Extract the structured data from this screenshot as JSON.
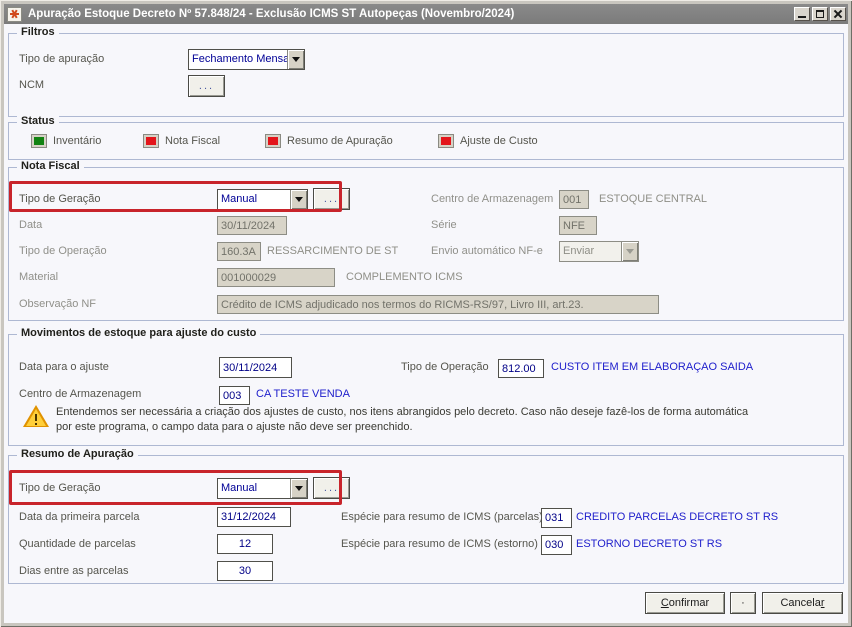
{
  "window": {
    "title": "Apuração Estoque Decreto Nº 57.848/24 - Exclusão ICMS ST Autopeças (Novembro/2024)"
  },
  "groups": {
    "filtros": {
      "title": "Filtros",
      "tipo_apuracao_label": "Tipo de apuração",
      "tipo_apuracao_value": "Fechamento Mensal",
      "ncm_label": "NCM",
      "ncm_button_label": "..."
    },
    "status": {
      "title": "Status",
      "items": [
        {
          "label": "Inventário",
          "color": "#128312",
          "style": "background:#128312"
        },
        {
          "label": "Nota Fiscal",
          "color": "#E3151B",
          "style": "background:#E3151B"
        },
        {
          "label": "Resumo de Apuração",
          "color": "#E3151B",
          "style": "background:#E3151B"
        },
        {
          "label": "Ajuste de Custo",
          "color": "#E3151B",
          "style": "background:#E3151B"
        }
      ]
    },
    "nota_fiscal": {
      "title": "Nota Fiscal",
      "tipo_geracao_label": "Tipo de Geração",
      "tipo_geracao_value": "Manual",
      "browse_button_label": "...",
      "centro_label": "Centro de Armazenagem",
      "centro_code": "001",
      "centro_desc": "ESTOQUE CENTRAL",
      "data_label": "Data",
      "data_value": "30/11/2024",
      "serie_label": "Série",
      "serie_value": "NFE",
      "tipo_operacao_label": "Tipo de Operação",
      "tipo_operacao_code": "160.3A",
      "tipo_operacao_desc": "RESSARCIMENTO DE ST",
      "envio_label": "Envio automático NF-e",
      "envio_value": "Enviar",
      "material_label": "Material",
      "material_code": "001000029",
      "material_desc": "COMPLEMENTO ICMS",
      "observacao_label": "Observação NF",
      "observacao_value": "Crédito de ICMS adjudicado nos termos do RICMS-RS/97, Livro III, art.23."
    },
    "movimentos": {
      "title": "Movimentos de estoque para ajuste do custo",
      "data_ajuste_label": "Data para o ajuste",
      "data_ajuste_value": "30/11/2024",
      "tipo_operacao_label": "Tipo de Operação",
      "tipo_operacao_code": "812.00",
      "tipo_operacao_desc": "CUSTO ITEM EM ELABORAÇAO SAIDA",
      "centro_label": "Centro de Armazenagem",
      "centro_code": "003",
      "centro_desc": "CA TESTE VENDA",
      "warning_line1": "Entendemos ser necessária a criação dos ajustes de custo, nos itens abrangidos pelo decreto. Caso não deseje fazê-los de forma automática",
      "warning_line2": "por este programa, o campo data para o ajuste não deve ser preenchido."
    },
    "resumo": {
      "title": "Resumo de Apuração",
      "tipo_geracao_label": "Tipo de Geração",
      "tipo_geracao_value": "Manual",
      "browse_button_label": "...",
      "data_parcela_label": "Data da primeira parcela",
      "data_parcela_value": "31/12/2024",
      "qtd_label": "Quantidade de parcelas",
      "qtd_value": "12",
      "dias_label": "Dias entre as parcelas",
      "dias_value": "30",
      "especie_parcelas_label": "Espécie para resumo de ICMS (parcelas)",
      "especie_parcelas_code": "031",
      "especie_parcelas_desc": "CREDITO PARCELAS DECRETO ST RS",
      "especie_estorno_label": "Espécie para resumo de ICMS (estorno)",
      "especie_estorno_code": "030",
      "especie_estorno_desc": "ESTORNO DECRETO ST RS"
    }
  },
  "footer": {
    "confirmar_accel": "C",
    "confirmar_rest": "onfirmar",
    "dot_label": "·",
    "cancelar_pre": "Cancela",
    "cancelar_accel": "r"
  },
  "annotation": {
    "style": "border-color:#C8242B",
    "color": "#C8242B"
  }
}
